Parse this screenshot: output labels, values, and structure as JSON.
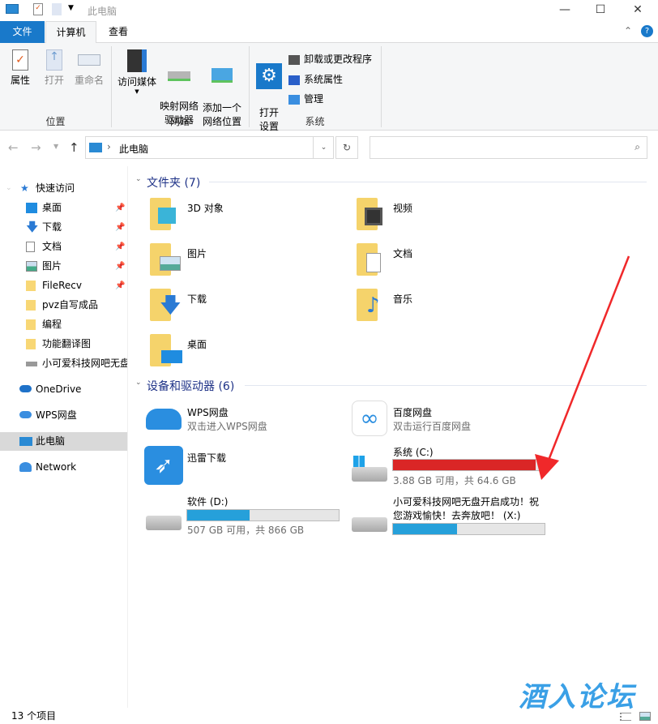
{
  "title_bar": {
    "title": "此电脑",
    "minimize": "—",
    "maximize": "☐",
    "close": "✕"
  },
  "tabs": [
    "文件",
    "计算机",
    "查看"
  ],
  "ribbon": {
    "groups": [
      {
        "name": "位置",
        "buttons": [
          "属性",
          "打开",
          "重命名"
        ]
      },
      {
        "name": "网络",
        "buttons": [
          "访问媒体",
          "映射网络\n驱动器",
          "添加一个\n网络位置"
        ]
      },
      {
        "name": "系统",
        "buttons": [
          "打开\n设置"
        ],
        "small": [
          "卸载或更改程序",
          "系统属性",
          "管理"
        ]
      }
    ]
  },
  "address": {
    "path": "此电脑",
    "search_placeholder": ""
  },
  "sidebar": {
    "quick_access": "快速访问",
    "items": [
      {
        "label": "桌面",
        "pinned": true
      },
      {
        "label": "下载",
        "pinned": true
      },
      {
        "label": "文档",
        "pinned": true
      },
      {
        "label": "图片",
        "pinned": true
      },
      {
        "label": "FileRecv",
        "pinned": true
      },
      {
        "label": "pvz自写成品",
        "pinned": false
      },
      {
        "label": "编程",
        "pinned": false
      },
      {
        "label": "功能翻译图",
        "pinned": false
      },
      {
        "label": "小可爱科技网吧无盘",
        "pinned": false
      }
    ],
    "roots": [
      "OneDrive",
      "WPS网盘",
      "此电脑",
      "Network"
    ]
  },
  "folders": {
    "header": "文件夹 (7)",
    "items": [
      "3D 对象",
      "视频",
      "图片",
      "文档",
      "下载",
      "音乐",
      "桌面"
    ]
  },
  "devices": {
    "header": "设备和驱动器 (6)",
    "wps": {
      "name": "WPS网盘",
      "sub": "双击进入WPS网盘"
    },
    "baidu": {
      "name": "百度网盘",
      "sub": "双击运行百度网盘"
    },
    "xunlei": {
      "name": "迅雷下载"
    },
    "c": {
      "name": "系统 (C:)",
      "info": "3.88 GB 可用，共 64.6 GB",
      "used_percent": 94,
      "color": "#da2626"
    },
    "d": {
      "name": "软件 (D:)",
      "info": "507 GB 可用，共 866 GB",
      "used_percent": 41,
      "color": "#26a0da"
    },
    "x": {
      "name1": "小可爱科技网吧无盘开启成功！祝",
      "name2": "您游戏愉快！去奔放吧！ (X:)",
      "used_percent": 42,
      "color": "#26a0da"
    }
  },
  "status": {
    "count": "13 个项目"
  },
  "watermark": "酒入论坛"
}
